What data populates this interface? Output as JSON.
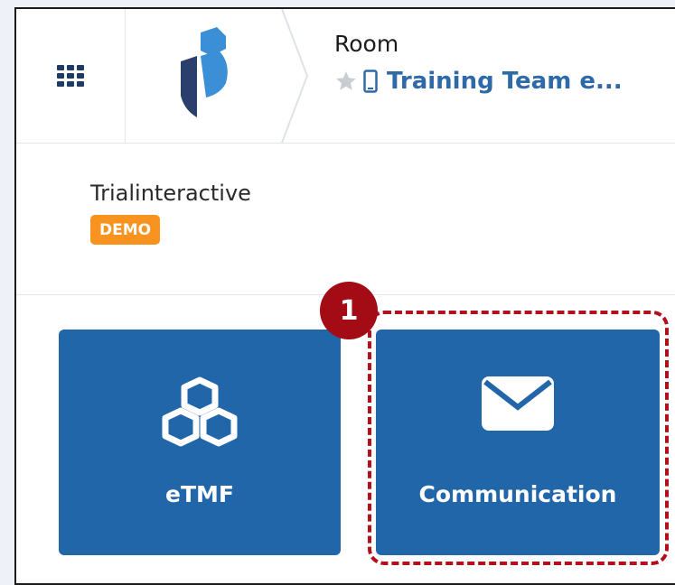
{
  "header": {
    "breadcrumb_label": "Room",
    "room_name": "Training Team e...",
    "icons": [
      "apps-grid-icon",
      "trialinteractive-logo",
      "star-icon",
      "mobile-icon"
    ]
  },
  "sponsor": {
    "name": "Trialinteractive",
    "badge": "DEMO"
  },
  "tiles": [
    {
      "label": "eTMF",
      "icon": "cubes-icon"
    },
    {
      "label": "Communication",
      "icon": "envelope-icon"
    }
  ],
  "annotation": {
    "step_number": "1"
  },
  "colors": {
    "tile_bg": "#2266aa",
    "room_link": "#2f6aa8",
    "badge_bg": "#f7931e",
    "annotation": "#b3101c",
    "logo_dark": "#2a3f6b",
    "logo_light": "#3a8fd6"
  }
}
